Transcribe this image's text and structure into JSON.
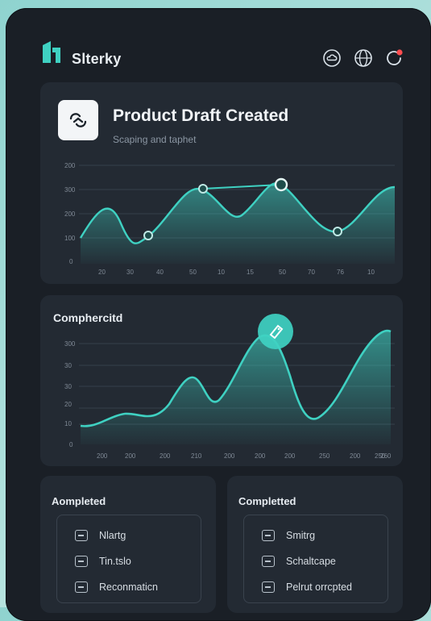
{
  "app": {
    "name": "Slterky"
  },
  "header_icons": [
    "cloud-icon",
    "globe-icon",
    "notification-icon"
  ],
  "colors": {
    "accent": "#3fd1c2",
    "background": "#1a1f26",
    "card": "#232a33",
    "notification_dot": "#ff4d4f"
  },
  "card1": {
    "title": "Product Draft Created",
    "subtitle": "Scaping and taphet",
    "chart_data": {
      "type": "area",
      "y_ticks": [
        "0",
        "100",
        "200",
        "300",
        "200"
      ],
      "x_ticks": [
        "20",
        "30",
        "40",
        "50",
        "10",
        "15",
        "50",
        "70",
        "76",
        "10"
      ],
      "values": [
        100,
        190,
        110,
        300,
        200,
        315,
        120,
        300
      ],
      "markers": [
        110,
        300,
        315,
        120
      ]
    }
  },
  "card2": {
    "title": "Comphercitd",
    "chart_data": {
      "type": "area",
      "y_ticks": [
        "0",
        "10",
        "20",
        "30",
        "30",
        "300"
      ],
      "x_ticks": [
        "200",
        "200",
        "200",
        "210",
        "200",
        "200",
        "200",
        "250",
        "200",
        "250",
        "260"
      ],
      "values": [
        8,
        10,
        15,
        18,
        30,
        18,
        45,
        8,
        40
      ],
      "highlight_icon": "tag-icon"
    }
  },
  "list_left": {
    "title": "Aompleted",
    "items": [
      {
        "label": "Nlartg",
        "icon": "minus-box-icon"
      },
      {
        "label": "Tin.tslo",
        "icon": "minus-box-icon"
      },
      {
        "label": "Reconmaticn",
        "icon": "check-box-icon"
      }
    ]
  },
  "list_right": {
    "title": "Completted",
    "items": [
      {
        "label": "Smitrg",
        "icon": "minus-box-icon"
      },
      {
        "label": "Schaltcape",
        "icon": "minus-box-icon"
      },
      {
        "label": "Pelrut orrcpted",
        "icon": "check-box-icon"
      }
    ]
  }
}
